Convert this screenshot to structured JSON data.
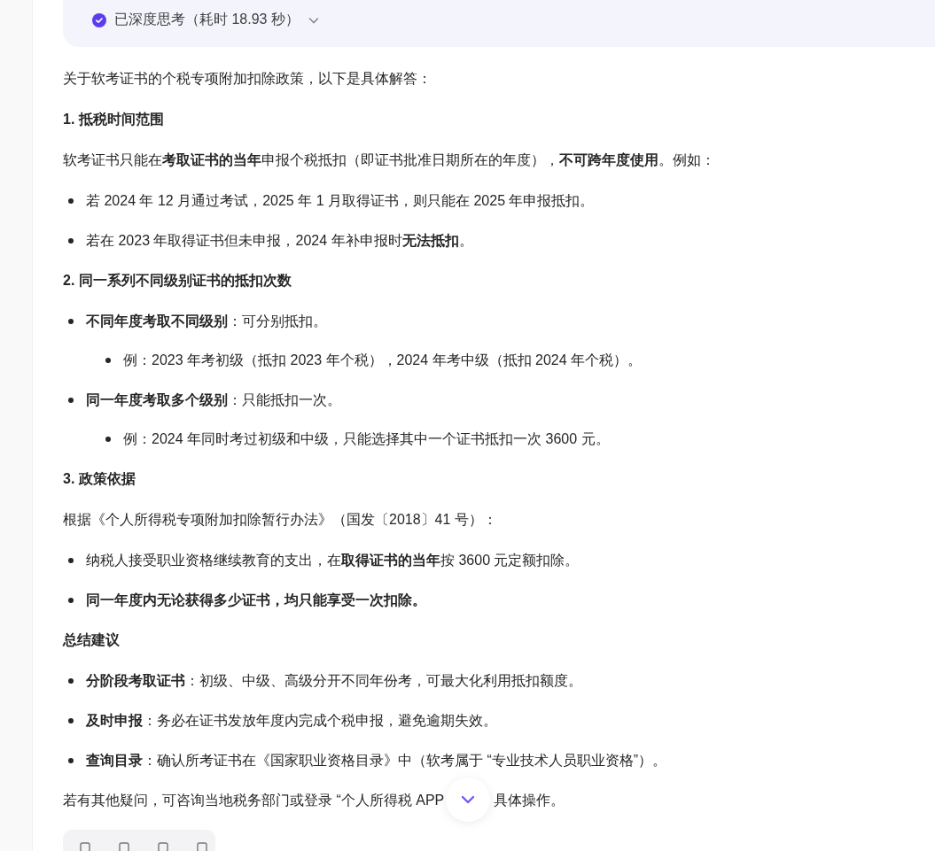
{
  "thinking": {
    "label": "已深度思考（耗时 18.93 秒）",
    "expanded": false
  },
  "blocks": [
    {
      "kind": "paragraph",
      "text": "关于软考证书的个税专项附加扣除政策，以下是具体解答："
    },
    {
      "kind": "heading",
      "text": "1. 抵税时间范围"
    },
    {
      "kind": "paragraph",
      "text": "软考证书只能在**考取证书的当年**申报个税抵扣（即证书批准日期所在的年度），**不可跨年度使用**。例如："
    },
    {
      "kind": "list",
      "items": [
        {
          "text": "若 2024 年 12 月通过考试，2025 年 1 月取得证书，则只能在 2025 年申报抵扣。"
        },
        {
          "text": "若在 2023 年取得证书但未申报，2024 年补申报时**无法抵扣**。"
        }
      ]
    },
    {
      "kind": "heading",
      "text": "2. 同一系列不同级别证书的抵扣次数"
    },
    {
      "kind": "list",
      "items": [
        {
          "text": "**不同年度考取不同级别**：可分别抵扣。",
          "children": [
            {
              "text": "例：2023 年考初级（抵扣 2023 年个税），2024 年考中级（抵扣 2024 年个税）。"
            }
          ]
        },
        {
          "text": "**同一年度考取多个级别**：只能抵扣一次。",
          "children": [
            {
              "text": "例：2024 年同时考过初级和中级，只能选择其中一个证书抵扣一次 3600 元。"
            }
          ]
        }
      ]
    },
    {
      "kind": "heading",
      "text": "3. 政策依据"
    },
    {
      "kind": "paragraph",
      "text": "根据《个人所得税专项附加扣除暂行办法》（国发〔2018〕41 号）："
    },
    {
      "kind": "list",
      "items": [
        {
          "text": "纳税人接受职业资格继续教育的支出，在**取得证书的当年**按 3600 元定额扣除。"
        },
        {
          "text": "**同一年度内无论获得多少证书，均只能享受一次扣除。**"
        }
      ]
    },
    {
      "kind": "heading",
      "text": "总结建议"
    },
    {
      "kind": "list",
      "items": [
        {
          "text": "**分阶段考取证书**：初级、中级、高级分开不同年份考，可最大化利用抵扣额度。"
        },
        {
          "text": "**及时申报**：务必在证书发放年度内完成个税申报，避免逾期失效。"
        },
        {
          "text": "**查询目录**：确认所考证书在《国家职业资格目录》中（软考属于 “专业技术人员职业资格”）。"
        }
      ]
    }
  ],
  "closing": {
    "before": "若有其他疑问，可咨询当地税务部门或登录 “个人所得税 APP",
    "after": "具体操作。"
  }
}
